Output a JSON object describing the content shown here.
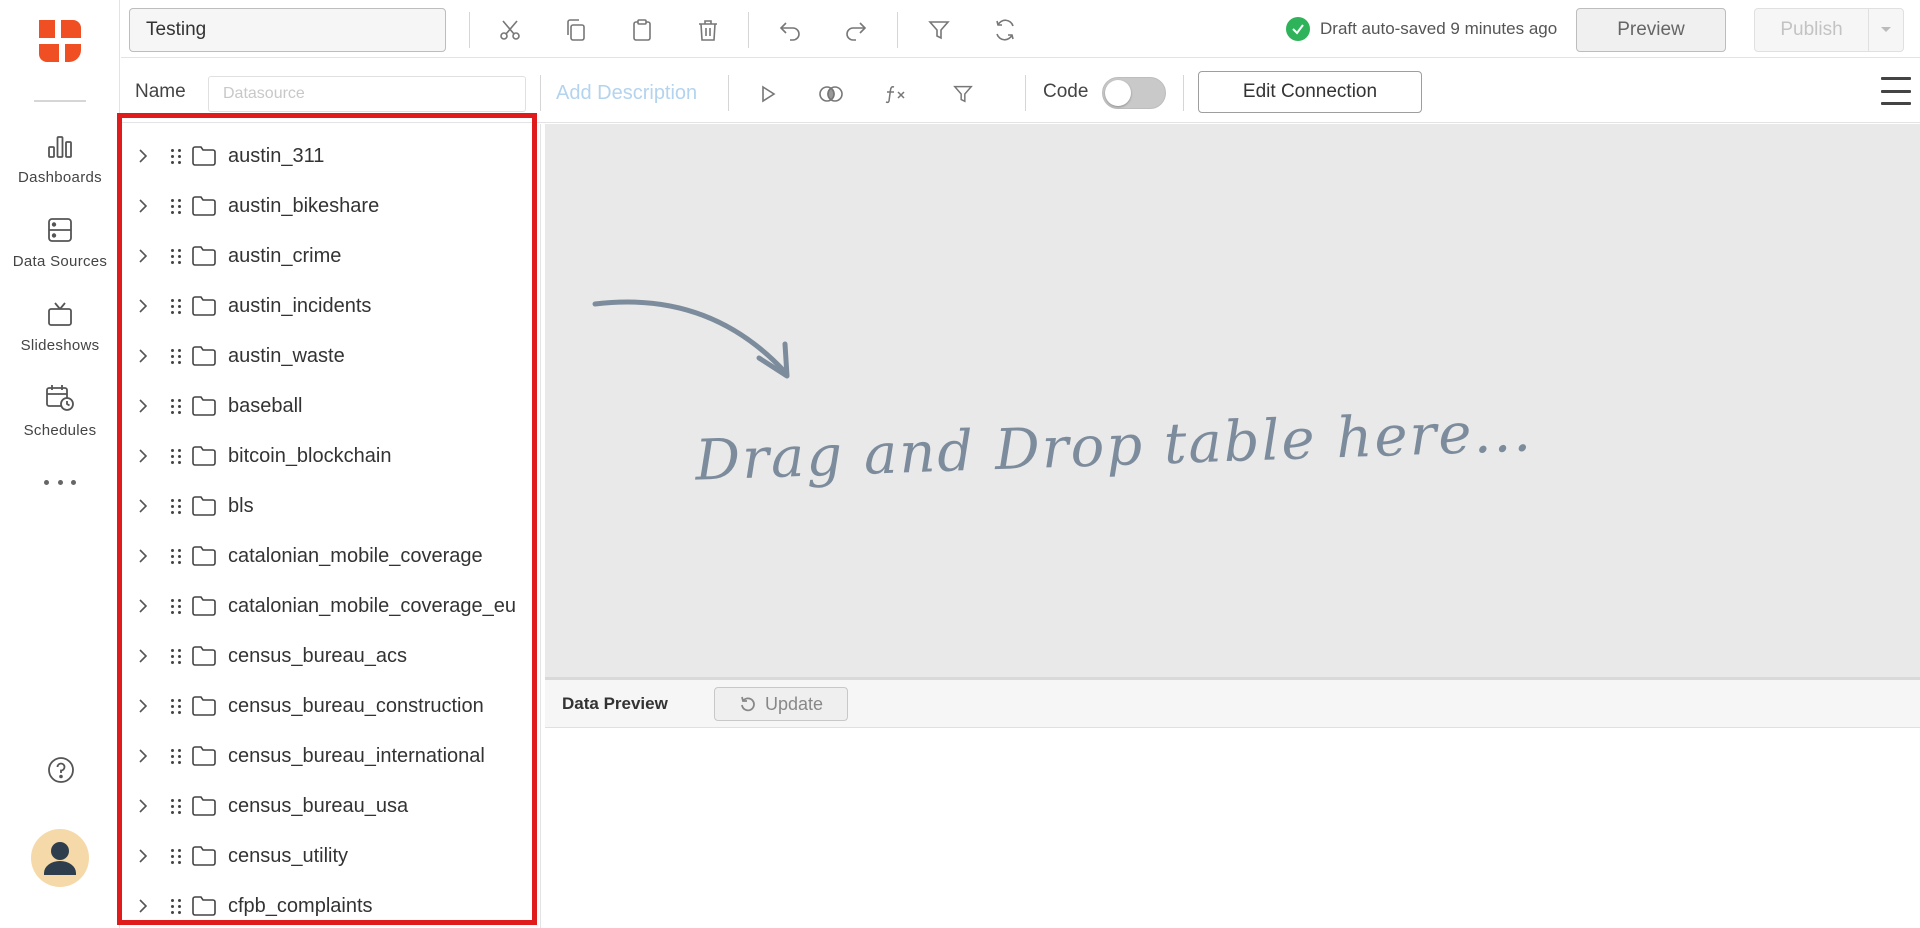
{
  "nav": {
    "items": [
      {
        "label": "Dashboards",
        "icon": "bar-chart-icon"
      },
      {
        "label": "Data Sources",
        "icon": "database-icon"
      },
      {
        "label": "Slideshows",
        "icon": "tv-icon"
      },
      {
        "label": "Schedules",
        "icon": "calendar-clock-icon"
      }
    ]
  },
  "toolbar": {
    "title_value": "Testing",
    "status_text": "Draft auto-saved 9 minutes ago",
    "preview_label": "Preview",
    "publish_label": "Publish"
  },
  "subbar": {
    "name_label": "Name",
    "datasource_placeholder": "Datasource",
    "add_description": "Add Description",
    "code_label": "Code",
    "code_enabled": false,
    "edit_connection": "Edit Connection"
  },
  "tree": {
    "items": [
      "austin_311",
      "austin_bikeshare",
      "austin_crime",
      "austin_incidents",
      "austin_waste",
      "baseball",
      "bitcoin_blockchain",
      "bls",
      "catalonian_mobile_coverage",
      "catalonian_mobile_coverage_eu",
      "census_bureau_acs",
      "census_bureau_construction",
      "census_bureau_international",
      "census_bureau_usa",
      "census_utility",
      "cfpb_complaints"
    ]
  },
  "canvas": {
    "drop_text": "Drag and Drop table here..."
  },
  "preview": {
    "title": "Data Preview",
    "update_label": "Update"
  },
  "colors": {
    "brand": "#f04e23",
    "success": "#2eb35a",
    "highlight_frame": "#e01b1b",
    "link_muted": "#b4d3ee"
  }
}
